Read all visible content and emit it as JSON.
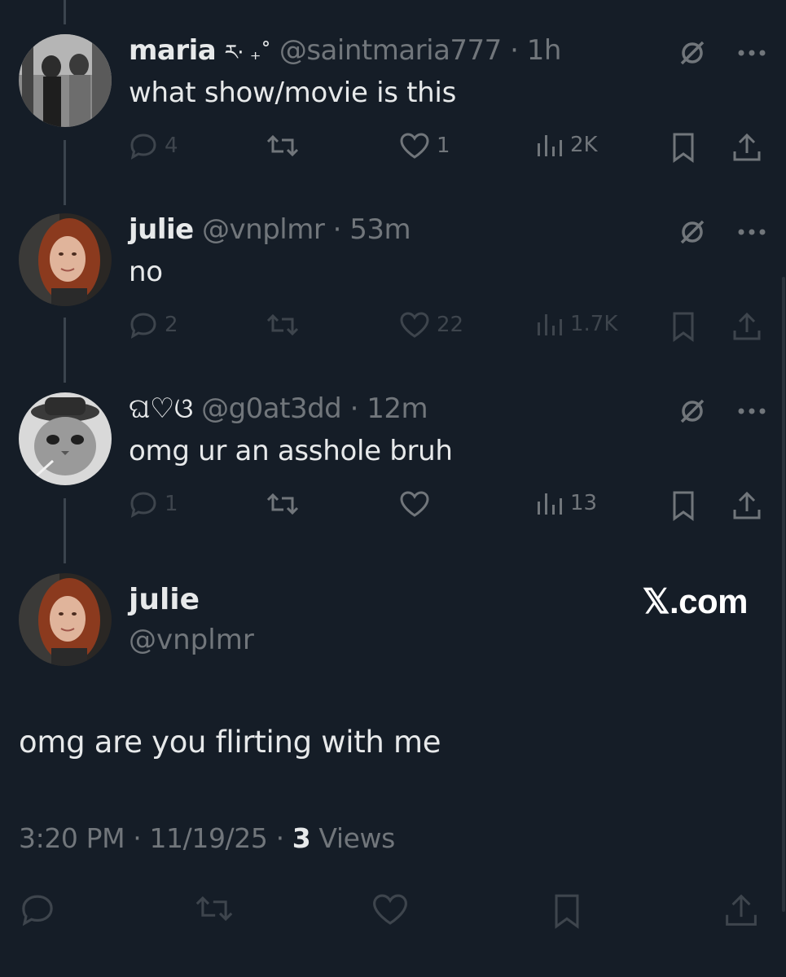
{
  "tweets": [
    {
      "name": "maria",
      "name_decor": "ར· ₊˚",
      "handle": "@saintmaria777",
      "time": "1h",
      "text": "what show/movie is this",
      "replies": "4",
      "likes": "1",
      "views": "2K",
      "avatar": "grayscale-two-people-photo"
    },
    {
      "name": "julie",
      "handle": "@vnplmr",
      "time": "53m",
      "text": "no",
      "replies": "2",
      "likes": "22",
      "views": "1.7K",
      "avatar": "red-haired-woman-photo"
    },
    {
      "name_decor": "ଘ♡ଓ",
      "handle": "@g0at3dd",
      "time": "12m",
      "text": "omg ur an asshole bruh",
      "replies": "1",
      "views": "13",
      "avatar": "cat-with-hat-photo"
    }
  ],
  "main": {
    "name": "julie",
    "handle": "@vnplmr",
    "text": "omg are you flirting with me",
    "time": "3:20 PM",
    "date": "11/19/25",
    "views_count": "3",
    "views_label": "Views",
    "watermark": "𝕏.com"
  },
  "separator": "·",
  "icons": [
    "reply-icon",
    "retweet-icon",
    "like-icon",
    "views-icon",
    "bookmark-icon",
    "share-icon",
    "grok-icon",
    "more-icon"
  ],
  "colors": {
    "background": "#151d27",
    "text": "#e7e9ea",
    "muted": "#71767b",
    "thread_line": "#3b444e"
  }
}
